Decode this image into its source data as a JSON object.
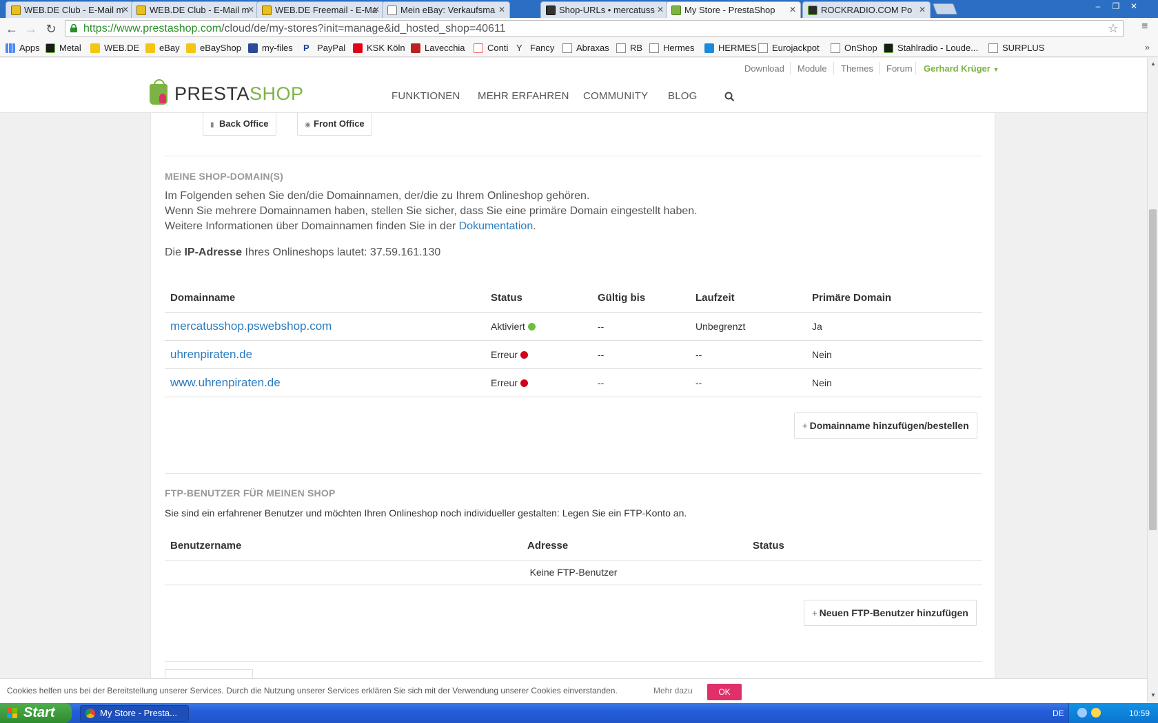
{
  "browser": {
    "tabs": [
      {
        "label": "WEB.DE Club - E-Mail m",
        "active": false
      },
      {
        "label": "WEB.DE Club - E-Mail m",
        "active": false
      },
      {
        "label": "WEB.DE Freemail - E-Ma",
        "active": false
      },
      {
        "label": "Mein eBay: Verkaufsma",
        "active": false
      },
      {
        "label": "Shop-URLs • mercatuss",
        "active": false
      },
      {
        "label": "My Store - PrestaShop",
        "active": true
      },
      {
        "label": "ROCKRADIO.COM Po",
        "active": false
      }
    ],
    "url": {
      "scheme": "https://",
      "host": "www.prestashop.com",
      "path": "/cloud/de/my-stores?init=manage&id_hosted_shop=40611"
    },
    "bookmarks": [
      {
        "label": "Apps",
        "icon": "apps-grid-icon"
      },
      {
        "label": "Metal",
        "icon": "metal-icon"
      },
      {
        "label": "WEB.DE",
        "icon": "webde-icon"
      },
      {
        "label": "eBay",
        "icon": "ebay-icon"
      },
      {
        "label": "eBayShop",
        "icon": "ebay-icon"
      },
      {
        "label": "my-files",
        "icon": "myfiles-icon"
      },
      {
        "label": "PayPal",
        "icon": "paypal-icon"
      },
      {
        "label": "KSK Köln",
        "icon": "sparkasse-icon"
      },
      {
        "label": "Lavecchia",
        "icon": "lavecchia-icon"
      },
      {
        "label": "Conti",
        "icon": "conti-icon"
      },
      {
        "label": "Fancy",
        "icon": "fancy-icon"
      },
      {
        "label": "Abraxas",
        "icon": "page-icon"
      },
      {
        "label": "RB",
        "icon": "page-icon"
      },
      {
        "label": "Hermes",
        "icon": "page-icon"
      },
      {
        "label": "HERMES",
        "icon": "hermes-icon"
      },
      {
        "label": "Eurojackpot",
        "icon": "page-icon"
      },
      {
        "label": "OnShop",
        "icon": "page-icon"
      },
      {
        "label": "Stahlradio - Loude...",
        "icon": "stahlradio-icon"
      },
      {
        "label": "SURPLUS",
        "icon": "page-icon"
      }
    ],
    "bookmarks_more": "»"
  },
  "ps_header": {
    "top_links": [
      "Download",
      "Module",
      "Themes",
      "Forum"
    ],
    "user": "Gerhard Krüger",
    "logo_part1": "PRESTA",
    "logo_part2": "SHOP",
    "nav": [
      "FUNKTIONEN",
      "MEHR ERFAHREN",
      "COMMUNITY",
      "BLOG"
    ]
  },
  "office_buttons": {
    "back": "Back Office",
    "front": "Front Office"
  },
  "domains_section": {
    "title": "MEINE SHOP-DOMAIN(S)",
    "line1": "Im Folgenden sehen Sie den/die Domainnamen, der/die zu Ihrem Onlineshop gehören.",
    "line2": "Wenn Sie mehrere Domainnamen haben, stellen Sie sicher, dass Sie eine primäre Domain eingestellt haben.",
    "line3_prefix": "Weitere Informationen über Domainnamen finden Sie in der ",
    "line3_link": "Dokumentation",
    "line3_suffix": ".",
    "ip_prefix": "Die ",
    "ip_bold": "IP-Adresse",
    "ip_suffix": " Ihres Onlineshops lautet: 37.59.161.130",
    "columns": [
      "Domainname",
      "Status",
      "Gültig bis",
      "Laufzeit",
      "Primäre Domain"
    ],
    "rows": [
      {
        "domain": "mercatusshop.pswebshop.com",
        "status": "Aktiviert",
        "status_color": "#6cbf3a",
        "valid": "--",
        "term": "Unbegrenzt",
        "primary": "Ja"
      },
      {
        "domain": "uhrenpiraten.de",
        "status": "Erreur",
        "status_color": "#d0021b",
        "valid": "--",
        "term": "--",
        "primary": "Nein"
      },
      {
        "domain": "www.uhrenpiraten.de",
        "status": "Erreur",
        "status_color": "#d0021b",
        "valid": "--",
        "term": "--",
        "primary": "Nein"
      }
    ],
    "add_button": "Domainname hinzufügen/bestellen"
  },
  "ftp_section": {
    "title": "FTP-BENUTZER FÜR MEINEN SHOP",
    "intro": "Sie sind ein erfahrener Benutzer und möchten Ihren Onlineshop noch individueller gestalten: Legen Sie ein FTP-Konto an.",
    "columns": [
      "Benutzername",
      "Adresse",
      "Status"
    ],
    "empty": "Keine FTP-Benutzer",
    "add_button": "Neuen FTP-Benutzer hinzufügen"
  },
  "cookie": {
    "text": "Cookies helfen uns bei der Bereitstellung unserer Services. Durch die Nutzung unserer Services erklären Sie sich mit der Verwendung unserer Cookies einverstanden.",
    "more": "Mehr dazu",
    "ok": "OK"
  },
  "taskbar": {
    "start": "Start",
    "window": "My Store - Presta...",
    "lang": "DE",
    "time": "10:59"
  },
  "colors": {
    "prestashop_green": "#7cb342",
    "link_blue": "#2b7bbf",
    "cookie_ok_pink": "#e0306a"
  }
}
